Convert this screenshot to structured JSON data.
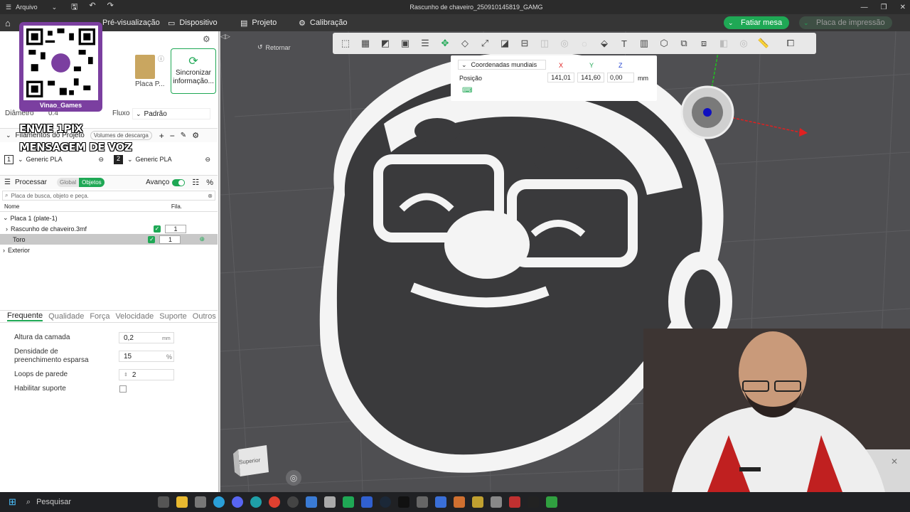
{
  "titlebar": {
    "file_label": "Arquivo",
    "title": "Rascunho de chaveiro_250910145819_GAMG"
  },
  "menubar": {
    "preview": "Pré-visualização",
    "device": "Dispositivo",
    "project": "Projeto",
    "calibration": "Calibração",
    "slice_button": "Fatiar mesa",
    "print_button": "Placa de impressão"
  },
  "left": {
    "plate_label": "Placa P...",
    "sync_label": "Sincronizar informação...",
    "diameter_label": "Diâmetro",
    "diameter_value": "0.4",
    "flow_label": "Fluxo",
    "flow_value": "Padrão",
    "filaments_title": "Filamentos do Projeto",
    "volumes_btn": "Volumes de descarga",
    "filaments": [
      {
        "num": "1",
        "name": "Generic PLA"
      },
      {
        "num": "2",
        "name": "Generic PLA"
      }
    ],
    "process_title": "Processar",
    "global_tab": "Global",
    "objects_tab": "Objetos",
    "advanced": "Avanço",
    "search_placeholder": "Placa de busca, objeto e peça.",
    "col_name": "Nome",
    "col_fila": "Fila.",
    "tree": {
      "plate": "Placa 1 (plate-1)",
      "obj1": "Rascunho de chaveiro.3mf",
      "obj1_val": "1",
      "obj2": "Toro",
      "obj2_val": "1",
      "exterior": "Exterior"
    },
    "tabs": [
      "Frequente",
      "Qualidade",
      "Força",
      "Velocidade",
      "Suporte",
      "Outros"
    ],
    "params": {
      "layer_label": "Altura da camada",
      "layer_value": "0,2",
      "layer_unit": "mm",
      "infill_label": "Densidade de preenchimento esparsa",
      "infill_value": "15",
      "infill_unit": "%",
      "walls_label": "Loops de parede",
      "walls_value": "2",
      "support_label": "Habilitar suporte"
    }
  },
  "overlay": {
    "channel": "Vinao_Games",
    "line1": "ENVIE 1PIX",
    "line2": "MENSAGEM DE VOZ"
  },
  "viewport": {
    "back": "Retornar",
    "coord_mode": "Coordenadas mundiais",
    "x_label": "X",
    "y_label": "Y",
    "z_label": "Z",
    "pos_label": "Posição",
    "x_val": "141,01",
    "y_val": "141,60",
    "z_val": "0,00",
    "unit": "mm",
    "cube_label": "Superior"
  },
  "taskbar": {
    "search": "Pesquisar"
  },
  "colors": {
    "accent": "#1fa855",
    "overlay_purple": "#7b3fa0",
    "axis_x": "#e02020",
    "axis_y": "#20c020"
  }
}
